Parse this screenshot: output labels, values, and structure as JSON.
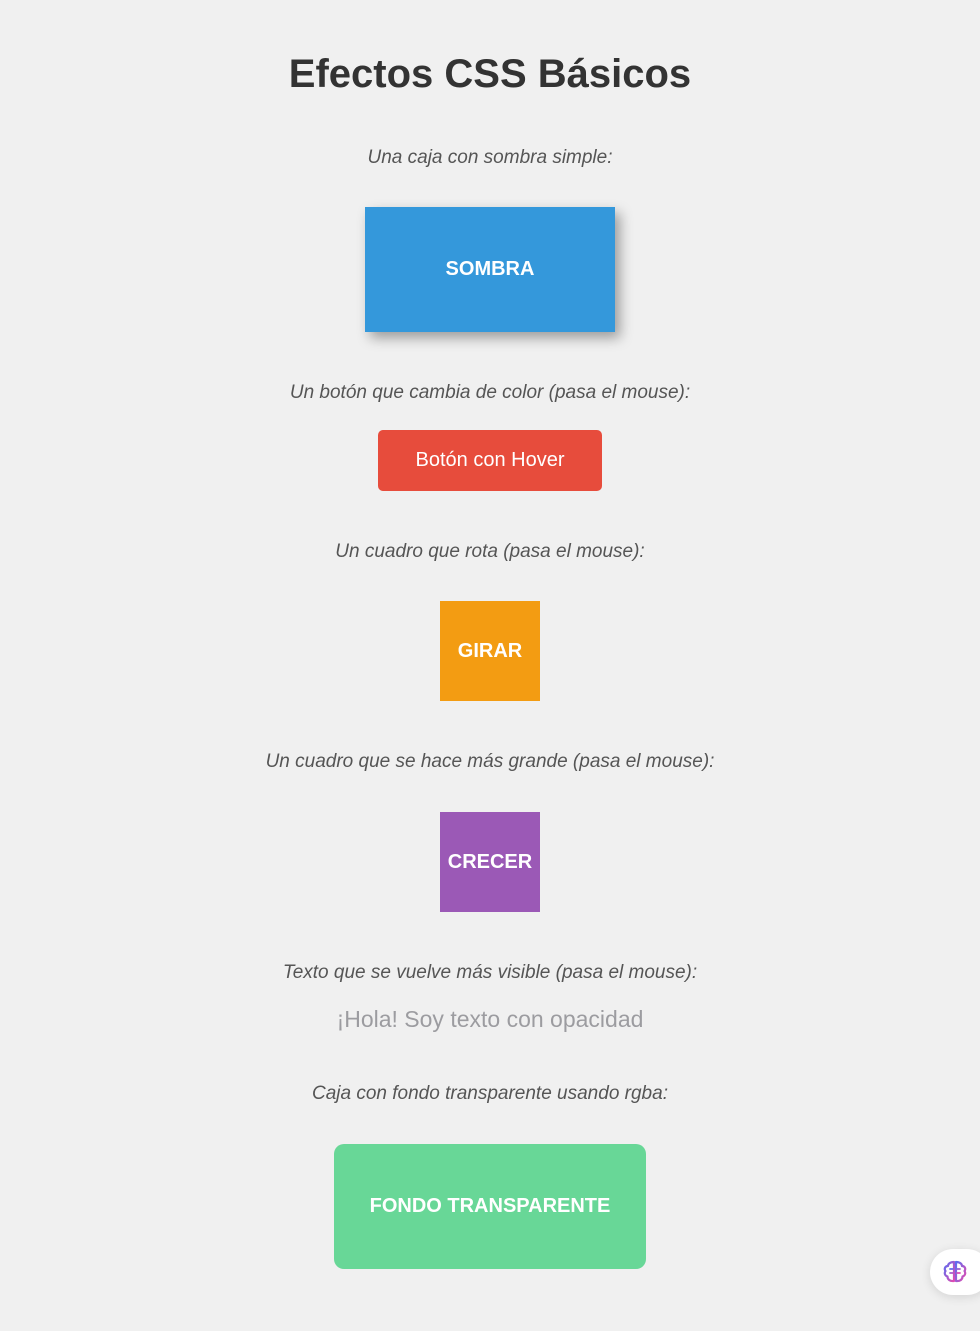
{
  "page": {
    "title": "Efectos CSS Básicos"
  },
  "sections": {
    "shadow": {
      "caption": "Una caja con sombra simple:",
      "box_label": "SOMBRA",
      "color": "#3498db"
    },
    "hover": {
      "caption": "Un botón que cambia de color (pasa el mouse):",
      "button_label": "Botón con Hover",
      "color": "#e74c3c"
    },
    "rotate": {
      "caption": "Un cuadro que rota (pasa el mouse):",
      "box_label": "GIRAR",
      "color": "#f39c12"
    },
    "grow": {
      "caption": "Un cuadro que se hace más grande (pasa el mouse):",
      "box_label": "CRECER",
      "color": "#9b59b6"
    },
    "opacity": {
      "caption": "Texto que se vuelve más visible (pasa el mouse):",
      "text": "¡Hola! Soy texto con opacidad"
    },
    "transparent": {
      "caption": "Caja con fondo transparente usando rgba:",
      "box_label": "FONDO TRANSPARENTE",
      "color": "#6cd89a"
    }
  },
  "floating_button": {
    "icon": "brain-icon"
  }
}
